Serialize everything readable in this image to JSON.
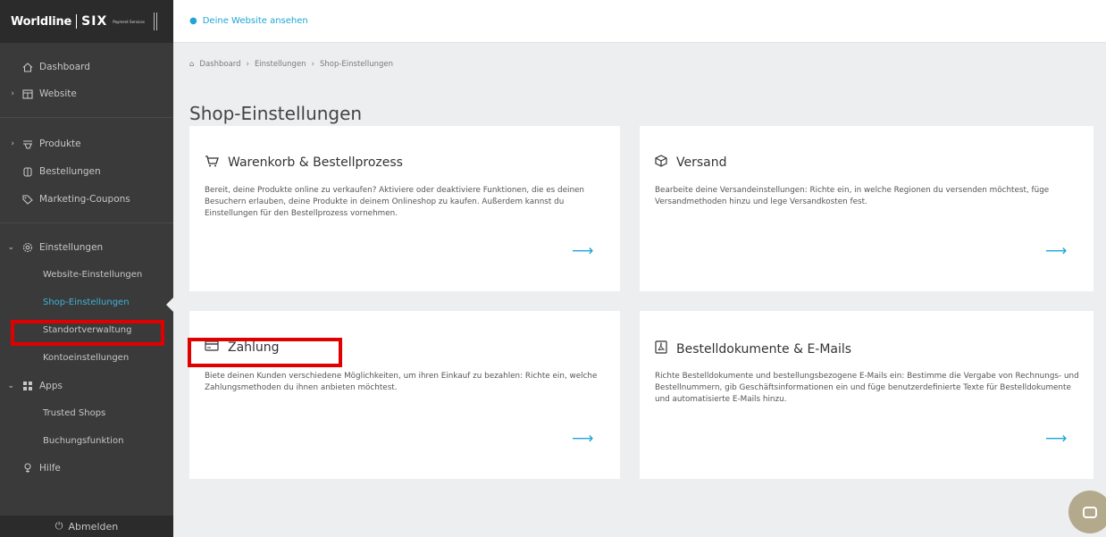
{
  "logo": {
    "brand": "Worldline",
    "partner": "SIX",
    "tagline": "Payment Services"
  },
  "sidebar": {
    "items": [
      {
        "label": "Dashboard",
        "icon": "home-icon"
      },
      {
        "label": "Website",
        "icon": "website-icon"
      },
      {
        "label": "Produkte",
        "icon": "products-icon"
      },
      {
        "label": "Bestellungen",
        "icon": "orders-icon"
      },
      {
        "label": "Marketing-Coupons",
        "icon": "coupon-icon"
      },
      {
        "label": "Einstellungen",
        "icon": "gear-icon"
      },
      {
        "label": "Apps",
        "icon": "apps-icon"
      },
      {
        "label": "Hilfe",
        "icon": "help-icon"
      }
    ],
    "settings_sub": [
      "Website-Einstellungen",
      "Shop-Einstellungen",
      "Standortverwaltung",
      "Kontoeinstellungen"
    ],
    "apps_sub": [
      "Trusted Shops",
      "Buchungsfunktion"
    ],
    "logout": "Abmelden"
  },
  "topbar": {
    "view_site": "Deine Website ansehen"
  },
  "breadcrumb": [
    "Dashboard",
    "Einstellungen",
    "Shop-Einstellungen"
  ],
  "page_title": "Shop-Einstellungen",
  "cards": [
    {
      "title": "Warenkorb & Bestellprozess",
      "text": "Bereit, deine Produkte online zu verkaufen? Aktiviere oder deaktiviere Funktionen, die es deinen Besuchern erlauben, deine Produkte in deinem Onlineshop zu kaufen. Außerdem kannst du Einstellungen für den Bestellprozess vornehmen."
    },
    {
      "title": "Versand",
      "text": "Bearbeite deine Versandeinstellungen: Richte ein, in welche Regionen du versenden möchtest, füge Versandmethoden hinzu und lege Versandkosten fest."
    },
    {
      "title": "Zahlung",
      "text": "Biete deinen Kunden verschiedene Möglichkeiten, um ihren Einkauf zu bezahlen: Richte ein, welche Zahlungsmethoden du ihnen anbieten möchtest."
    },
    {
      "title": "Bestelldokumente & E-Mails",
      "text": "Richte Bestelldokumente und bestellungsbezogene E-Mails ein: Bestimme die Vergabe von Rechnungs- und Bestellnummern, gib Geschäftsinformationen ein und füge benutzerdefinierte Texte für Bestelldokumente und automatisierte E-Mails hinzu."
    }
  ],
  "colors": {
    "accent": "#1fa6d6",
    "sidebar_bg": "#3a3a3a",
    "highlight": "#e00000",
    "chat": "#b3a98c"
  }
}
